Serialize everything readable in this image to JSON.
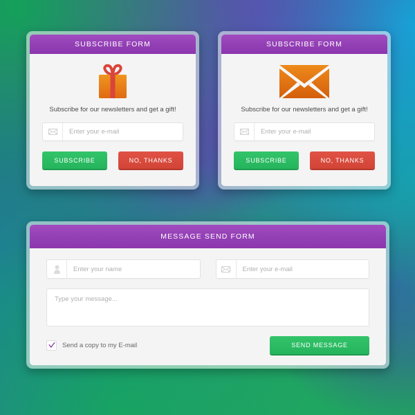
{
  "background": {
    "colors": [
      "#14a05a",
      "#5b4fb0",
      "#12a8d8",
      "#1a9c9c",
      "#3f4c9e",
      "#1fa85e",
      "#1c7f9b",
      "#2c5f9a"
    ]
  },
  "theme": {
    "header_purple": "#9340b5",
    "green": "#25b45c",
    "red": "#d14436",
    "orange": "#e07b18",
    "ribbon_red": "#d9453a",
    "card_bg": "#f4f4f4",
    "checkbox_check": "#8c36ae"
  },
  "cards": {
    "subscribe_gift": {
      "title": "SUBSCRIBE FORM",
      "icon": "gift-icon",
      "subtitle": "Subscribe for our newsletters and get a gift!",
      "email_field": {
        "icon": "envelope-icon",
        "placeholder": "Enter your e-mail",
        "value": ""
      },
      "primary_button": "SUBSCRIBE",
      "secondary_button": "NO, THANKS"
    },
    "subscribe_mail": {
      "title": "SUBSCRIBE FORM",
      "icon": "envelope-icon",
      "subtitle": "Subscribe for our newsletters and get a gift!",
      "email_field": {
        "icon": "envelope-icon",
        "placeholder": "Enter your e-mail",
        "value": ""
      },
      "primary_button": "SUBSCRIBE",
      "secondary_button": "NO, THANKS"
    },
    "message": {
      "title": "MESSAGE SEND FORM",
      "name_field": {
        "icon": "user-icon",
        "placeholder": "Enter your name",
        "value": ""
      },
      "email_field": {
        "icon": "envelope-icon",
        "placeholder": "Enter your e-mail",
        "value": ""
      },
      "message_field": {
        "placeholder": "Type your message...",
        "value": ""
      },
      "checkbox": {
        "label": "Send a copy to my E-mail",
        "checked": true,
        "icon": "check-icon"
      },
      "send_button": "SEND MESSAGE"
    }
  }
}
